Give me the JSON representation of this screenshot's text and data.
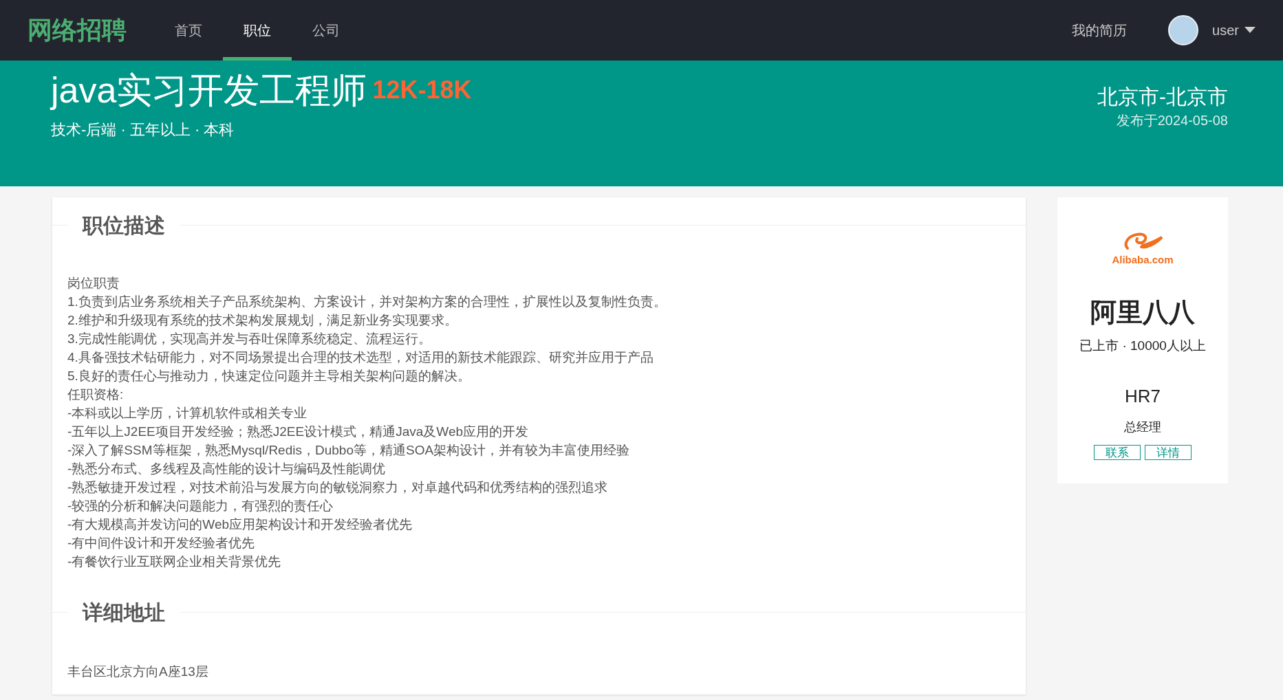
{
  "nav": {
    "logo": "网络招聘",
    "items": [
      {
        "label": "首页",
        "selected": false
      },
      {
        "label": "职位",
        "selected": true
      },
      {
        "label": "公司",
        "selected": false
      }
    ],
    "resume_link": "我的简历",
    "user": "user"
  },
  "job": {
    "title": "java实习开发工程师",
    "salary": "12K-18K",
    "meta": "技术-后端 · 五年以上 · 本科",
    "city": "北京市-北京市",
    "posted": "发布于2024-05-08"
  },
  "sections": [
    {
      "heading": "职位描述",
      "lines": [
        "岗位职责",
        "1.负责到店业务系统相关子产品系统架构、方案设计，并对架构方案的合理性，扩展性以及复制性负责。",
        "2.维护和升级现有系统的技术架构发展规划，满足新业务实现要求。",
        "3.完成性能调优，实现高并发与吞吐保障系统稳定、流程运行。",
        "4.具备强技术钻研能力，对不同场景提出合理的技术选型，对适用的新技术能跟踪、研究并应用于产品",
        "5.良好的责任心与推动力，快速定位问题并主导相关架构问题的解决。",
        "任职资格:",
        "-本科或以上学历，计算机软件或相关专业",
        "-五年以上J2EE项目开发经验；熟悉J2EE设计模式，精通Java及Web应用的开发",
        "-深入了解SSM等框架，熟悉Mysql/Redis，Dubbo等，精通SOA架构设计，并有较为丰富使用经验",
        "-熟悉分布式、多线程及高性能的设计与编码及性能调优",
        "-熟悉敏捷开发过程，对技术前沿与发展方向的敏锐洞察力，对卓越代码和优秀结构的强烈追求",
        "-较强的分析和解决问题能力，有强烈的责任心",
        "-有大规模高并发访问的Web应用架构设计和开发经验者优先",
        "-有中间件设计和开发经验者优先",
        "-有餐饮行业互联网企业相关背景优先"
      ]
    },
    {
      "heading": "详细地址",
      "lines": [
        "丰台区北京方向A座13层"
      ]
    }
  ],
  "company": {
    "logo_text": "Alibaba.com",
    "name": "阿里八八",
    "info": "已上市 · 10000人以上",
    "hr_name": "HR7",
    "hr_title": "总经理",
    "buttons": [
      "联系",
      "详情"
    ]
  }
}
